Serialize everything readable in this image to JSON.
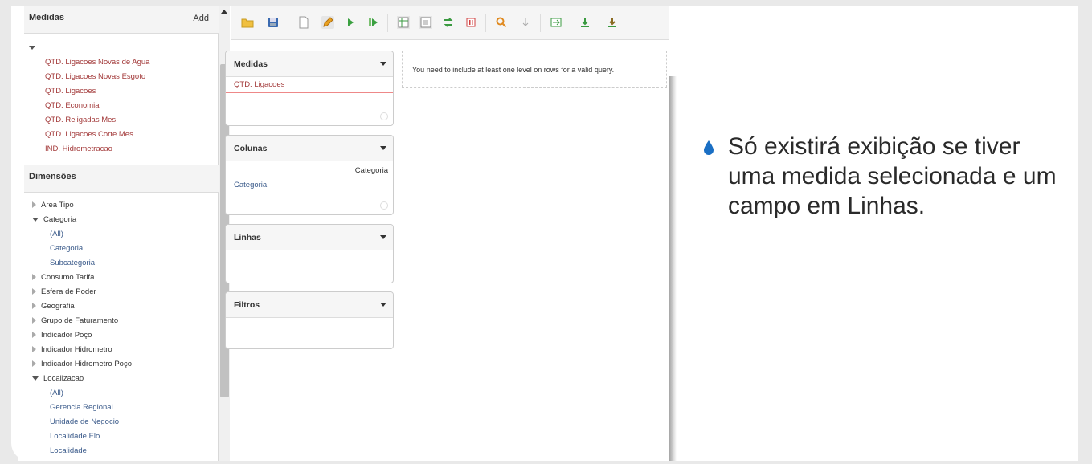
{
  "left_panel": {
    "measures_header": "Medidas",
    "add_label": "Add",
    "measures": [
      "QTD. Ligacoes Novas de Agua",
      "QTD. Ligacoes Novas Esgoto",
      "QTD. Ligacoes",
      "QTD. Economia",
      "QTD. Religadas Mes",
      "QTD. Ligacoes Corte Mes",
      "IND. Hidrometracao"
    ],
    "dimensions_header": "Dimensões",
    "dimensions": [
      {
        "label": "Area Tipo",
        "expanded": false
      },
      {
        "label": "Categoria",
        "expanded": true
      },
      {
        "label": "(All)",
        "sub": true
      },
      {
        "label": "Categoria",
        "sub": true
      },
      {
        "label": "Subcategoria",
        "sub": true
      },
      {
        "label": "Consumo Tarifa",
        "expanded": false
      },
      {
        "label": "Esfera de Poder",
        "expanded": false
      },
      {
        "label": "Geografia",
        "expanded": false
      },
      {
        "label": "Grupo de Faturamento",
        "expanded": false
      },
      {
        "label": "Indicador Poço",
        "expanded": false
      },
      {
        "label": "Indicador Hidrometro",
        "expanded": false
      },
      {
        "label": "Indicador Hidrometro Poço",
        "expanded": false
      },
      {
        "label": "Localizacao",
        "expanded": true
      },
      {
        "label": "(All)",
        "sub": true
      },
      {
        "label": "Gerencia Regional",
        "sub": true
      },
      {
        "label": "Unidade de Negocio",
        "sub": true
      },
      {
        "label": "Localidade Elo",
        "sub": true
      },
      {
        "label": "Localidade",
        "sub": true
      }
    ]
  },
  "toolbar": {
    "icons": [
      "open-folder-icon",
      "save-icon",
      "new-document-icon",
      "edit-pencil-icon",
      "run-icon",
      "run-step-icon",
      "table-icon",
      "grid-icon",
      "swap-icon",
      "pause-icon",
      "zoom-icon",
      "drill-down-icon",
      "export-icon",
      "download-icon",
      "download-alt-icon"
    ]
  },
  "zones": {
    "medidas": {
      "title": "Medidas",
      "item": "QTD. Ligacoes"
    },
    "colunas": {
      "title": "Colunas",
      "right_label": "Categoria",
      "item": "Categoria"
    },
    "linhas": {
      "title": "Linhas"
    },
    "filtros": {
      "title": "Filtros"
    }
  },
  "message": "You need to include at least one level on rows for a valid query.",
  "slide": {
    "bullet": "Só existirá exibição se tiver uma medida selecionada e um campo em Linhas."
  },
  "colors": {
    "measure_text": "#a33a3a",
    "dimension_sub_text": "#3a5a8a",
    "bullet_blue": "#1a6fc4"
  }
}
